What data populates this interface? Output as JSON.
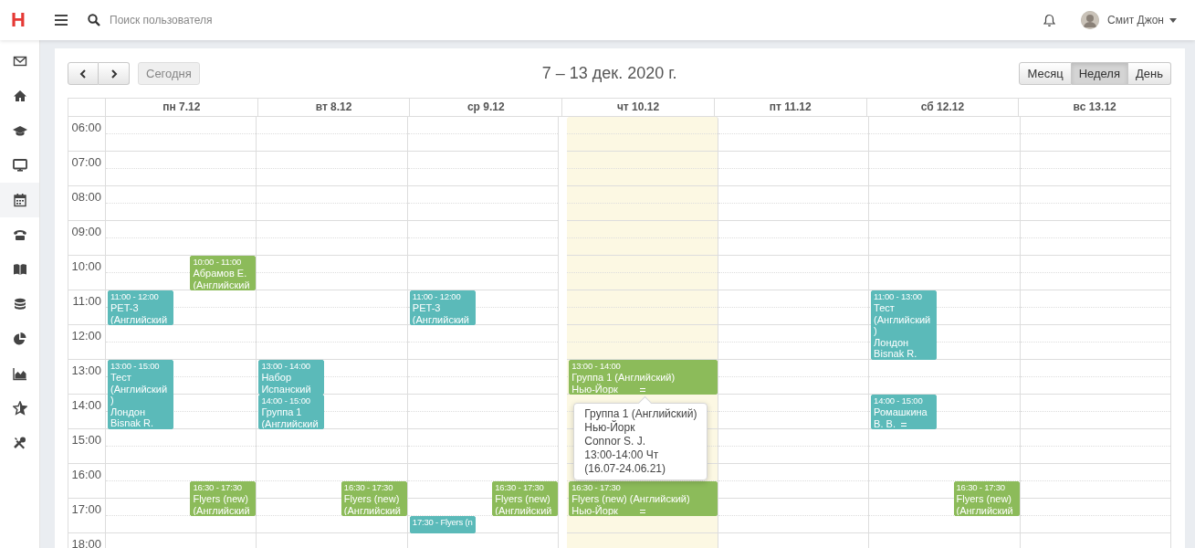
{
  "header": {
    "logo": "H",
    "search": {
      "placeholder": "Поиск пользователя"
    },
    "user": {
      "name": "Смит Джон"
    }
  },
  "sidebar": {
    "items": [
      {
        "selected": false
      },
      {
        "selected": false
      },
      {
        "selected": false
      },
      {
        "selected": false
      },
      {
        "selected": true
      },
      {
        "selected": false
      },
      {
        "selected": false
      },
      {
        "selected": false
      },
      {
        "selected": false
      },
      {
        "selected": false
      },
      {
        "selected": false
      },
      {
        "selected": false
      }
    ]
  },
  "toolbar": {
    "today_button": {
      "label": "Сегодня",
      "disabled": true
    },
    "title": "7 – 13 дек. 2020 г.",
    "views": [
      {
        "label": "Месяц",
        "selected": false
      },
      {
        "label": "Неделя",
        "selected": true
      },
      {
        "label": "День",
        "selected": false
      }
    ]
  },
  "calendar": {
    "hours": [
      "06:00",
      "07:00",
      "08:00",
      "09:00",
      "10:00",
      "11:00",
      "12:00",
      "13:00",
      "14:00",
      "15:00",
      "16:00",
      "17:00",
      "18:00"
    ],
    "days": [
      {
        "label": "пн 7.12",
        "today": false,
        "events": [
          {
            "kind": "right",
            "time": "10:00 - 11:00",
            "lines": [
              "Абрамов Е.",
              "(Английский"
            ],
            "color": "#8cbb5a",
            "resizable": false
          },
          {
            "kind": "left",
            "time": "11:00 - 12:00",
            "lines": [
              "PET-3",
              "(Английский"
            ],
            "color": "#5bbab9",
            "resizable": false
          },
          {
            "kind": "left",
            "time": "13:00 - 15:00",
            "lines": [
              "Тест",
              "(Английский",
              ")",
              "Лондон",
              "Bisnak R."
            ],
            "color": "#5bbab9",
            "resizable": false
          },
          {
            "kind": "right",
            "time": "16:30 - 17:30",
            "lines": [
              "Flyers (new)",
              "(Английский"
            ],
            "color": "#8cbb5a",
            "resizable": false
          }
        ]
      },
      {
        "label": "вт 8.12",
        "today": false,
        "events": [
          {
            "kind": "left",
            "time": "13:00 - 14:00",
            "lines": [
              "Набор",
              "Испанский"
            ],
            "color": "#5bbab9",
            "resizable": false
          },
          {
            "kind": "left",
            "time": "14:00 - 15:00",
            "lines": [
              "Группа 1",
              "(Английский"
            ],
            "color": "#5bbab9",
            "resizable": false
          },
          {
            "kind": "right",
            "time": "16:30 - 17:30",
            "lines": [
              "Flyers (new)",
              "(Английский"
            ],
            "color": "#8cbb5a",
            "resizable": false
          }
        ]
      },
      {
        "label": "ср 9.12",
        "today": false,
        "events": [
          {
            "kind": "left",
            "time": "11:00 - 12:00",
            "lines": [
              "PET-3",
              "(Английский"
            ],
            "color": "#5bbab9",
            "resizable": false
          },
          {
            "kind": "right",
            "time": "16:30 - 17:30",
            "lines": [
              "Flyers (new)",
              "(Английский"
            ],
            "color": "#8cbb5a",
            "resizable": false
          },
          {
            "kind": "left",
            "time": "17:30 - Flyers (n",
            "color": "#5bbab9",
            "resizable": false
          }
        ]
      },
      {
        "label": "чт 10.12",
        "today": true,
        "events": [
          {
            "kind": "wide",
            "time": "13:00 - 14:00",
            "lines": [
              "Группа 1 (Английский)",
              "Нью-Йорк"
            ],
            "color": "#8cbb5a",
            "resizable": true,
            "popover": [
              "Группа 1 (Английский)",
              "Нью-Йорк",
              "Connor S. J.",
              "13:00-14:00 Чт",
              "(16.07-24.06.21)"
            ]
          },
          {
            "kind": "wide",
            "time": "16:30 - 17:30",
            "lines": [
              "Flyers (new) (Английский)",
              "Нью-Йорк"
            ],
            "color": "#8cbb5a",
            "resizable": true
          }
        ]
      },
      {
        "label": "пт 11.12",
        "today": false
      },
      {
        "label": "сб 12.12",
        "today": false,
        "events": [
          {
            "kind": "left",
            "time": "11:00 - 13:00",
            "lines": [
              "Тест",
              "(Английский",
              ")",
              "Лондон",
              "Bisnak R."
            ],
            "color": "#5bbab9",
            "resizable": false
          },
          {
            "kind": "left",
            "time": "14:00 - 15:00",
            "lines": [
              "Ромашкина",
              "В. В."
            ],
            "color": "#5bbab9",
            "resizable": true
          },
          {
            "kind": "right",
            "time": "16:30 - 17:30",
            "lines": [
              "Flyers (new)",
              "(Английский"
            ],
            "color": "#8cbb5a",
            "resizable": false
          }
        ]
      },
      {
        "label": "вс 13.12",
        "today": false
      }
    ]
  }
}
